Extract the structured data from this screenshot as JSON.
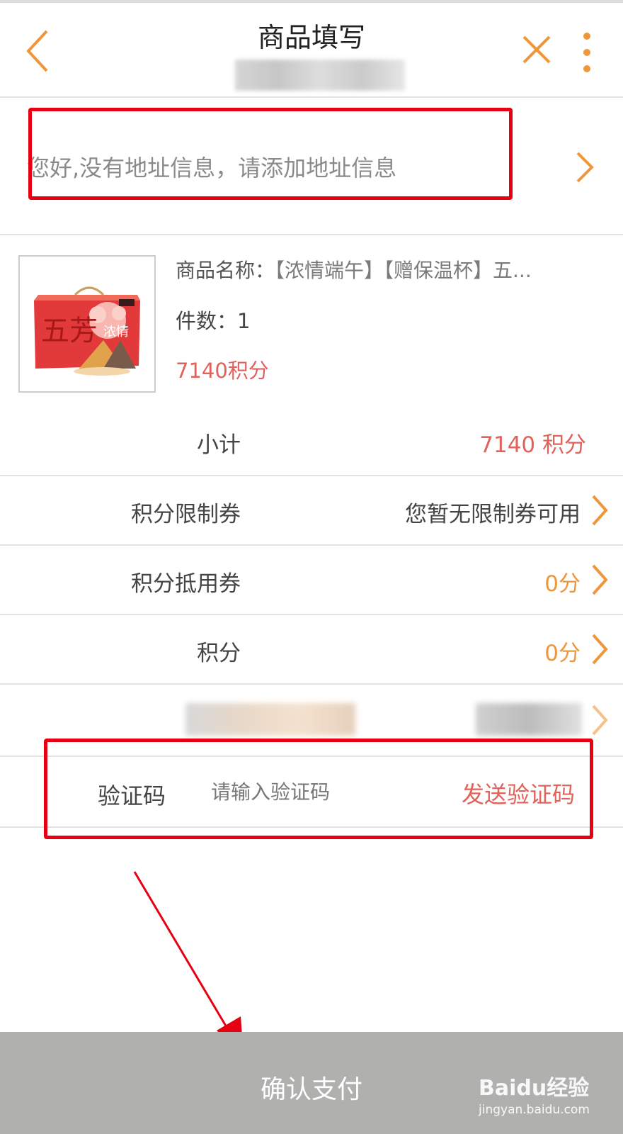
{
  "header": {
    "title": "商品填写"
  },
  "address": {
    "prompt": "您好,没有地址信息，请添加地址信息"
  },
  "product": {
    "name_label": "商品名称：",
    "name_value": "【浓情端午】【赠保温杯】五...",
    "count_label": "件数：",
    "count_value": "1",
    "price": "7140积分",
    "thumb_text": "五芳",
    "thumb_badge": "浓情"
  },
  "rows": {
    "subtotal": {
      "label": "小计",
      "value": "7140 积分"
    },
    "limit_coupon": {
      "label": "积分限制券",
      "value": "您暂无限制券可用"
    },
    "deduction_coupon": {
      "label": "积分抵用券",
      "value": "0分"
    },
    "points": {
      "label": "积分",
      "value": "0分"
    }
  },
  "verify": {
    "label": "验证码",
    "placeholder": "请输入验证码",
    "send_label": "发送验证码"
  },
  "footer": {
    "pay_label": "确认支付",
    "watermark_brand": "Baidu经验",
    "watermark_url": "jingyan.baidu.com"
  },
  "colors": {
    "accent_orange": "#f0963a",
    "price_red": "#e0625a",
    "annotation_red": "#e60012",
    "pay_bar_gray": "#b0b0ae"
  }
}
